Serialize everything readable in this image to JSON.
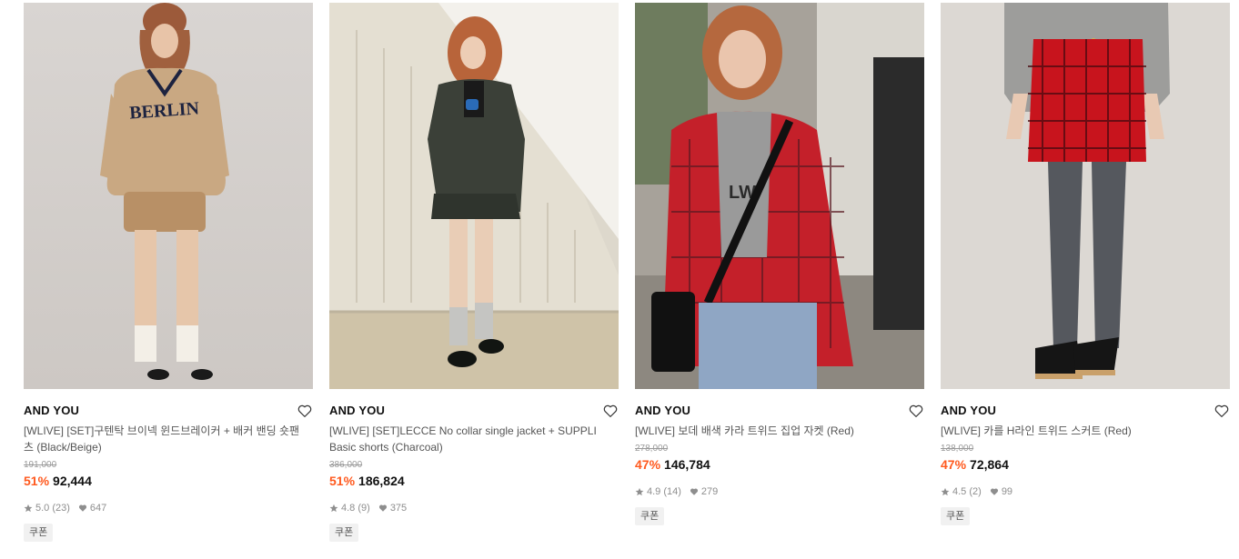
{
  "products": [
    {
      "brand": "AND YOU",
      "title": "[WLIVE] [SET]구텐탁 브이넥 윈드브레이커 + 배커 밴딩 숏팬츠 (Black/Beige)",
      "original_price": "191,000",
      "discount": "51%",
      "price": "92,444",
      "rating": "5.0",
      "reviews": "(23)",
      "likes": "647",
      "coupon": "쿠폰",
      "image_text": "BERLIN"
    },
    {
      "brand": "AND YOU",
      "title": "[WLIVE] [SET]LECCE No collar single jacket + SUPPLI Basic shorts (Charcoal)",
      "original_price": "386,000",
      "discount": "51%",
      "price": "186,824",
      "rating": "4.8",
      "reviews": "(9)",
      "likes": "375",
      "coupon": "쿠폰"
    },
    {
      "brand": "AND YOU",
      "title": "[WLIVE] 보데 배색 카라 트위드 집업 자켓 (Red)",
      "original_price": "278,000",
      "discount": "47%",
      "price": "146,784",
      "rating": "4.9",
      "reviews": "(14)",
      "likes": "279",
      "coupon": "쿠폰",
      "image_text": "LW"
    },
    {
      "brand": "AND YOU",
      "title": "[WLIVE] 카를 H라인 트위드 스커트 (Red)",
      "original_price": "138,000",
      "discount": "47%",
      "price": "72,864",
      "rating": "4.5",
      "reviews": "(2)",
      "likes": "99",
      "coupon": "쿠폰"
    }
  ],
  "colors": {
    "discount": "#ff5a1f",
    "muted": "#9a9a9a",
    "coupon_bg": "#f1f1f1"
  },
  "icons": {
    "wishlist": "heart-outline-icon",
    "rating": "star-icon",
    "likes": "heart-filled-icon"
  }
}
